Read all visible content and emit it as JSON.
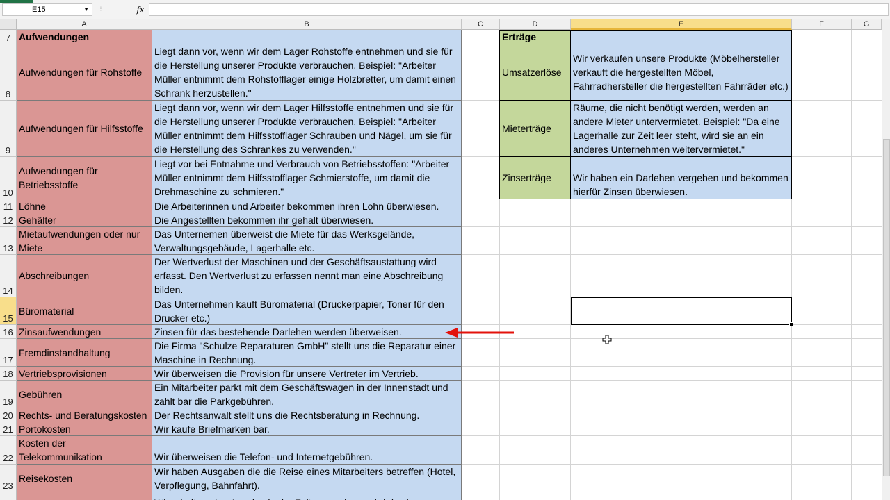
{
  "formula_bar": {
    "name_box": "E15",
    "fx": "fx",
    "formula": ""
  },
  "columns": [
    "A",
    "B",
    "C",
    "D",
    "E",
    "F",
    "G"
  ],
  "rows": [
    {
      "num": "7",
      "a": "Aufwendungen",
      "b": "",
      "d": "Erträge",
      "e": ""
    },
    {
      "num": "8",
      "a": "Aufwendungen für Rohstoffe",
      "b": "Liegt dann vor, wenn wir dem Lager Rohstoffe entnehmen und sie für die Herstellung unserer Produkte verbrauchen. Beispiel: \"Arbeiter Müller entnimmt dem Rohstofflager einige Holzbretter, um damit einen Schrank herzustellen.\"",
      "d": "Umsatzerlöse",
      "e": "Wir verkaufen unsere Produkte (Möbelhersteller verkauft die hergestellten Möbel, Fahrradhersteller die hergestellten Fahrräder etc.)"
    },
    {
      "num": "9",
      "a": "Aufwendungen für Hilfsstoffe",
      "b": "Liegt dann vor, wenn wir dem Lager Hilfsstoffe entnehmen und sie für die Herstellung unserer Produkte verbrauchen. Beispiel: \"Arbeiter Müller entnimmt dem Hilfsstofflager Schrauben und Nägel, um sie für die Herstellung des Schrankes zu verwenden.\"",
      "d": "Mieterträge",
      "e": "Räume, die nicht benötigt werden, werden an andere Mieter untervermietet. Beispiel: \"Da eine Lagerhalle zur Zeit leer steht, wird sie an ein anderes Unternehmen weitervermietet.\""
    },
    {
      "num": "10",
      "a": "Aufwendungen für Betriebsstoffe",
      "b": "Liegt vor bei Entnahme und Verbrauch von Betriebsstoffen: \"Arbeiter Müller entnimmt dem Hilfsstofflager Schmierstoffe, um damit die Drehmaschine zu schmieren.\"",
      "d": "Zinserträge",
      "e": "Wir haben ein Darlehen vergeben und bekommen hierfür Zinsen überwiesen."
    },
    {
      "num": "11",
      "a": "Löhne",
      "b": "Die Arbeiterinnen und Arbeiter bekommen ihren Lohn überwiesen."
    },
    {
      "num": "12",
      "a": "Gehälter",
      "b": "Die Angestellten bekommen ihr gehalt überwiesen."
    },
    {
      "num": "13",
      "a": "Mietaufwendungen oder nur Miete",
      "b": "Das Unternemen überweist die Miete für das Werksgelände, Verwaltungsgebäude, Lagerhalle etc."
    },
    {
      "num": "14",
      "a": "Abschreibungen",
      "b": "Der Wertverlust der Maschinen und der Geschäftsaustattung wird erfasst. Den Wertverlust zu erfassen nennt man eine Abschreibung bilden."
    },
    {
      "num": "15",
      "a": "Büromaterial",
      "b": "Das Unternehmen kauft Büromaterial (Druckerpapier, Toner für den Drucker etc.)"
    },
    {
      "num": "16",
      "a": "Zinsaufwendungen",
      "b": "Zinsen für das bestehende Darlehen werden überweisen."
    },
    {
      "num": "17",
      "a": "Fremdinstandhaltung",
      "b": "Die Firma \"Schulze Reparaturen GmbH\" stellt uns die Reparatur einer Maschine in Rechnung."
    },
    {
      "num": "18",
      "a": "Vertriebsprovisionen",
      "b": "Wir überweisen die Provision für unsere Vertreter im Vertrieb."
    },
    {
      "num": "19",
      "a": "Gebühren",
      "b": "Ein Mitarbeiter parkt mit dem Geschäftswagen in der Innenstadt und zahlt bar die Parkgebühren."
    },
    {
      "num": "20",
      "a": "Rechts- und Beratungskosten",
      "b": "Der Rechtsanwalt stellt uns die Rechtsberatung in Rechnung."
    },
    {
      "num": "21",
      "a": "Portokosten",
      "b": "Wir kaufe Briefmarken bar."
    },
    {
      "num": "22",
      "a": "Kosten der Telekommunikation",
      "b": "Wir überweisen die Telefon- und Internetgebühren."
    },
    {
      "num": "23",
      "a": "Reisekosten",
      "b": "Wir haben Ausgaben die die Reise eines Mitarbeiters betreffen (Hotel, Verpflegung, Bahnfahrt)."
    },
    {
      "num": "",
      "a": "",
      "b": "Wir erhalten eine Anzeige in der Zeitung und uns wird das in"
    }
  ],
  "colors": {
    "expense_label": "#da9694",
    "description": "#c5d9f1",
    "income_label": "#c4d79b",
    "arrow": "#e3120b"
  },
  "icons": {
    "arrow": "red-left-arrow",
    "cursor": "cell-select-cursor"
  }
}
